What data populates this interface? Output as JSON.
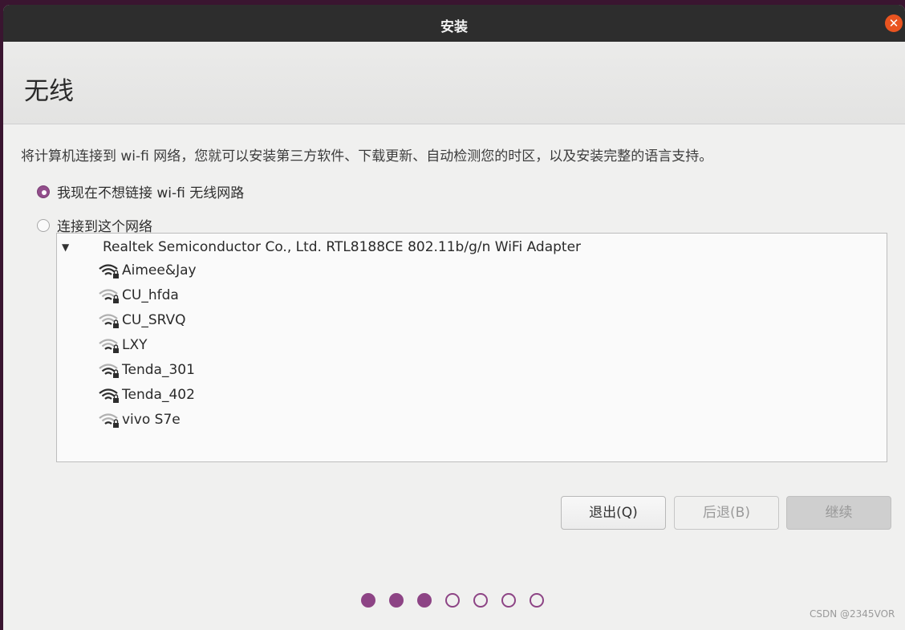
{
  "window": {
    "title": "安装",
    "close_icon": "close-icon"
  },
  "header": {
    "title": "无线"
  },
  "description": "将计算机连接到 wi-fi 网络，您就可以安装第三方软件、下载更新、自动检测您的时区，以及安装完整的语言支持。",
  "options": [
    {
      "label": "我现在不想链接 wi-fi 无线网路",
      "checked": true
    },
    {
      "label": "连接到这个网络",
      "checked": false
    }
  ],
  "adapter": {
    "name": "Realtek Semiconductor Co., Ltd. RTL8188CE 802.11b/g/n WiFi Adapter",
    "expanded": true,
    "networks": [
      {
        "ssid": "Aimee&Jay",
        "icon": "wifi-signal-strong-locked-icon"
      },
      {
        "ssid": "CU_hfda",
        "icon": "wifi-signal-weak-locked-icon"
      },
      {
        "ssid": "CU_SRVQ",
        "icon": "wifi-signal-weak-locked-icon"
      },
      {
        "ssid": "LXY",
        "icon": "wifi-signal-weak-locked-icon"
      },
      {
        "ssid": "Tenda_301",
        "icon": "wifi-signal-medium-locked-icon"
      },
      {
        "ssid": "Tenda_402",
        "icon": "wifi-signal-strong-locked-icon"
      },
      {
        "ssid": "vivo S7e",
        "icon": "wifi-signal-weak-locked-icon"
      }
    ]
  },
  "buttons": {
    "quit": "退出(Q)",
    "back": "后退(B)",
    "continue": "继续"
  },
  "progress": {
    "total_steps": 7,
    "completed_steps": 3
  },
  "watermark": "CSDN @2345VOR",
  "colors": {
    "accent": "#8d4485",
    "close": "#e95420",
    "titlebar": "#2d2d2d"
  }
}
